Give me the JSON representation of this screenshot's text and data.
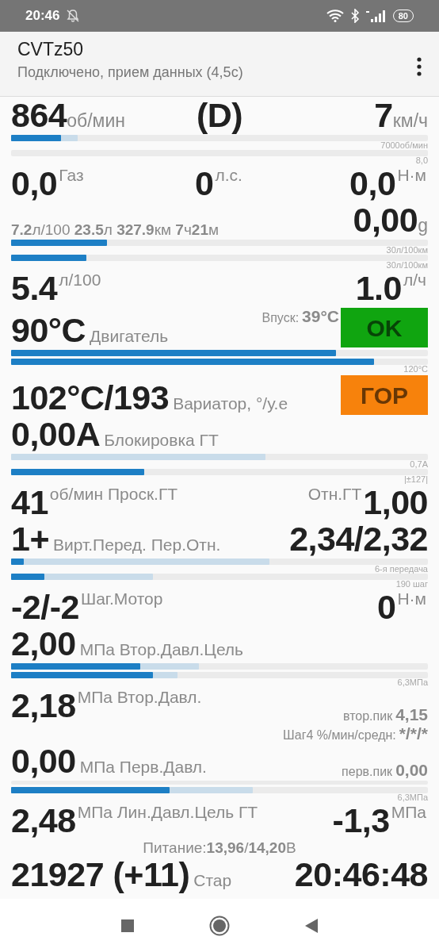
{
  "status_bar": {
    "time": "20:46",
    "battery": "80"
  },
  "app_bar": {
    "title": "CVTz50",
    "subtitle": "Подключено, прием данных (4,5с)"
  },
  "rows": [
    {
      "kind": "readings",
      "left": [
        {
          "kind": "big",
          "text": "864"
        },
        {
          "kind": "unit",
          "text": "об/мин"
        }
      ],
      "center": [
        {
          "kind": "big",
          "text": "(D)"
        }
      ],
      "right": [
        {
          "kind": "big",
          "text": "7"
        },
        {
          "kind": "unit",
          "text": "км/ч"
        }
      ]
    },
    {
      "kind": "bars",
      "bars": [
        {
          "fills": [
            {
              "kind": "peak",
              "level": 0.16
            },
            {
              "kind": "current",
              "level": 0.12
            }
          ],
          "caption": "7000об/мин"
        },
        {
          "caption": "8,0"
        }
      ]
    },
    {
      "kind": "readings",
      "left": [
        {
          "kind": "big",
          "text": "0,0"
        },
        {
          "kind": "sup",
          "text": "Газ"
        }
      ],
      "center": [
        {
          "kind": "big",
          "text": "0"
        },
        {
          "kind": "sup",
          "text": "л.с."
        }
      ],
      "right": [
        {
          "kind": "big",
          "text": "0,0"
        },
        {
          "kind": "sup",
          "text": "Н·м"
        }
      ]
    },
    {
      "kind": "readings",
      "left": [
        {
          "kind": "rich",
          "text": "**7.2**л/100 **23.5**л **327.9**км **7**ч**21**м"
        }
      ],
      "right": [
        {
          "kind": "big",
          "text": "0,00"
        },
        {
          "kind": "unit",
          "text": "g"
        }
      ]
    },
    {
      "kind": "bars",
      "bars": [
        {
          "fills": [
            {
              "kind": "current",
              "level": 0.23
            }
          ],
          "caption": "30л/100км"
        },
        {
          "fills": [
            {
              "kind": "current",
              "level": 0.18
            }
          ],
          "caption": "30л/100км"
        }
      ]
    },
    {
      "kind": "readings",
      "left": [
        {
          "kind": "big",
          "text": "5.4"
        },
        {
          "kind": "sup",
          "text": "л/100"
        }
      ],
      "right": [
        {
          "kind": "big",
          "text": "1.0"
        },
        {
          "kind": "sup",
          "text": "л/ч"
        }
      ]
    },
    {
      "kind": "readings",
      "left": [
        {
          "kind": "big",
          "text": "90°C"
        },
        {
          "kind": "label",
          "text": "Двигатель"
        }
      ],
      "right": [
        {
          "kind": "small",
          "text": "Впуск:"
        },
        {
          "kind": "smallbold",
          "text": "39°C"
        },
        {
          "kind": "badge",
          "text": "OK",
          "color": "#10a510"
        }
      ]
    },
    {
      "kind": "bars",
      "bars": [
        {
          "fills": [
            {
              "kind": "current",
              "level": 0.78
            }
          ]
        },
        {
          "fills": [
            {
              "kind": "current",
              "level": 0.87
            }
          ],
          "caption": "120°C"
        }
      ]
    },
    {
      "kind": "readings",
      "left": [
        {
          "kind": "big",
          "text": "102°C/193"
        },
        {
          "kind": "label",
          "text": "Вариатор, °/у.е"
        }
      ],
      "right": [
        {
          "kind": "badge",
          "text": "ГОР",
          "color": "#f7820c"
        }
      ]
    },
    {
      "kind": "readings",
      "left": [
        {
          "kind": "big",
          "text": "0,00A"
        },
        {
          "kind": "label",
          "text": "Блокировка ГТ"
        }
      ]
    },
    {
      "kind": "bars",
      "bars": [
        {
          "fills": [
            {
              "kind": "peak",
              "level": 0.61
            }
          ],
          "caption": "0,7A"
        },
        {
          "fills": [
            {
              "kind": "current",
              "level": 0.32
            }
          ],
          "caption": "|±127|"
        }
      ]
    },
    {
      "kind": "readings",
      "left": [
        {
          "kind": "big",
          "text": "41"
        },
        {
          "kind": "sup",
          "text": "об/мин Проск.ГТ"
        }
      ],
      "right": [
        {
          "kind": "sup",
          "text": "Отн.ГТ"
        },
        {
          "kind": "big",
          "text": "1,00"
        }
      ]
    },
    {
      "kind": "readings",
      "left": [
        {
          "kind": "big",
          "text": "1+"
        },
        {
          "kind": "label",
          "text": "Вирт.Перед. Пер.Отн."
        }
      ],
      "right": [
        {
          "kind": "big",
          "text": "2,34/2,32"
        }
      ]
    },
    {
      "kind": "bars",
      "bars": [
        {
          "fills": [
            {
              "kind": "peak",
              "level": 0.62
            },
            {
              "kind": "current",
              "level": 0.03
            }
          ],
          "caption": "6-я передача"
        },
        {
          "fills": [
            {
              "kind": "peak",
              "level": 0.34
            },
            {
              "kind": "current",
              "level": 0.08
            }
          ],
          "caption": "190 шаг"
        }
      ]
    },
    {
      "kind": "readings",
      "left": [
        {
          "kind": "big",
          "text": "-2/-2"
        },
        {
          "kind": "sup",
          "text": "Шаг.Мотор"
        }
      ],
      "right": [
        {
          "kind": "big",
          "text": "0"
        },
        {
          "kind": "sup",
          "text": "Н·м"
        }
      ]
    },
    {
      "kind": "readings",
      "left": [
        {
          "kind": "big",
          "text": "2,00"
        },
        {
          "kind": "label",
          "text": "МПа Втор.Давл.Цель"
        }
      ]
    },
    {
      "kind": "bars",
      "bars": [
        {
          "fills": [
            {
              "kind": "peak",
              "level": 0.45
            },
            {
              "kind": "current",
              "level": 0.31
            }
          ]
        },
        {
          "fills": [
            {
              "kind": "peak",
              "level": 0.4
            },
            {
              "kind": "current",
              "level": 0.34
            }
          ],
          "caption": "6,3МПа"
        }
      ]
    },
    {
      "kind": "readings",
      "left": [
        {
          "kind": "big",
          "text": "2,18"
        },
        {
          "kind": "sup",
          "text": "МПа Втор.Давл."
        }
      ],
      "right": [
        {
          "kind": "small",
          "text": "втор.пик"
        },
        {
          "kind": "smallbold",
          "text": "4,15"
        }
      ]
    },
    {
      "kind": "readings",
      "right": [
        {
          "kind": "small",
          "text": "Шаг4 %/мин/средн:"
        },
        {
          "kind": "smallbold",
          "text": "*/*/*"
        }
      ]
    },
    {
      "kind": "readings",
      "left": [
        {
          "kind": "big",
          "text": "0,00"
        },
        {
          "kind": "label",
          "text": "МПа Перв.Давл."
        }
      ],
      "right": [
        {
          "kind": "small",
          "text": "перв.пик"
        },
        {
          "kind": "smallbold",
          "text": "0,00"
        }
      ]
    },
    {
      "kind": "bars",
      "bars": [
        {
          "kind": "empty"
        },
        {
          "fills": [
            {
              "kind": "peak",
              "level": 0.58
            },
            {
              "kind": "current",
              "level": 0.38
            }
          ],
          "caption": "6,3МПа"
        }
      ]
    },
    {
      "kind": "readings",
      "left": [
        {
          "kind": "big",
          "text": "2,48"
        },
        {
          "kind": "sup",
          "text": "МПа Лин.Давл.Цель ГТ"
        }
      ],
      "right": [
        {
          "kind": "big",
          "text": "-1,3"
        },
        {
          "kind": "sup",
          "text": "МПа"
        }
      ]
    },
    {
      "kind": "readings",
      "center": [
        {
          "kind": "rich",
          "text": "Питание:**13,96**/**14,20**В"
        }
      ]
    },
    {
      "kind": "readings",
      "left": [
        {
          "kind": "big",
          "text": "21927 (+11)"
        },
        {
          "kind": "label",
          "text": "Стар"
        }
      ],
      "right": [
        {
          "kind": "big",
          "text": "20:46:48"
        }
      ]
    }
  ]
}
